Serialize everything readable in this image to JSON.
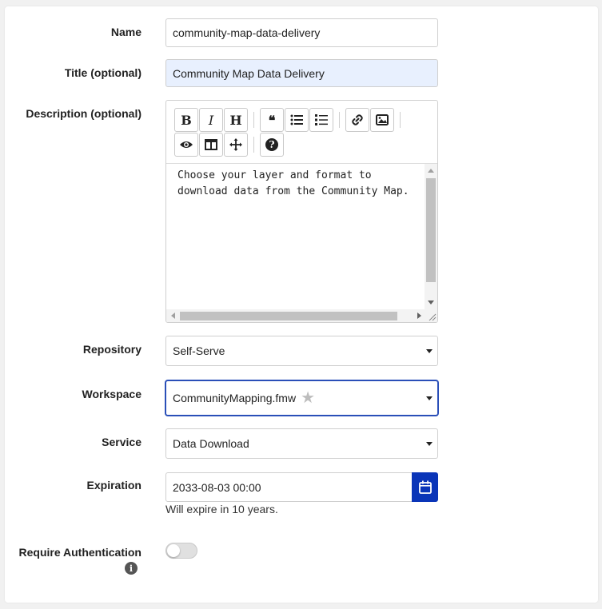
{
  "fields": {
    "name": {
      "label": "Name",
      "value": "community-map-data-delivery"
    },
    "title": {
      "label": "Title (optional)",
      "value": "Community Map Data Delivery"
    },
    "description": {
      "label": "Description (optional)",
      "value": "Choose your layer and format to\ndownload data from the Community Map.",
      "toolbar": [
        "bold-icon",
        "italic-icon",
        "heading-icon",
        "quote-icon",
        "unordered-list-icon",
        "ordered-list-icon",
        "link-icon",
        "image-icon",
        "preview-icon",
        "side-by-side-icon",
        "fullscreen-icon",
        "help-icon"
      ],
      "toolbar_glyphs": {
        "bold": "B",
        "italic": "I",
        "heading": "H",
        "quote": "❝",
        "help": "?"
      }
    },
    "repository": {
      "label": "Repository",
      "value": "Self-Serve"
    },
    "workspace": {
      "label": "Workspace",
      "value": "CommunityMapping.fmw"
    },
    "service": {
      "label": "Service",
      "value": "Data Download"
    },
    "expiration": {
      "label": "Expiration",
      "value": "2033-08-03 00:00",
      "hint": "Will expire in 10 years."
    },
    "require_auth": {
      "label": "Require Authentication",
      "enabled": false
    }
  },
  "colors": {
    "accent": "#0a35b8",
    "autofill_bg": "#e8f0fe",
    "focus_border": "#2a4fb8"
  }
}
